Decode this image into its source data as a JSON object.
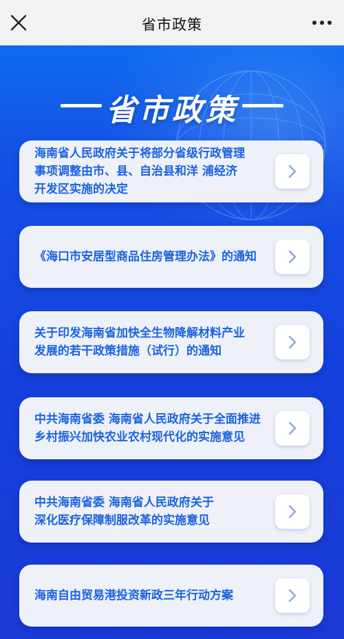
{
  "topbar": {
    "title": "省市政策",
    "close_icon": "close-icon",
    "more_icon": "more-icon"
  },
  "hero": {
    "title": "省市政策"
  },
  "policies": [
    {
      "label": "海南省人民政府关于将部分省级行政管理\n事项调整由市、县、自治县和洋 浦经济\n开发区实施的决定",
      "icon": "chevron-right-icon"
    },
    {
      "label": "《海口市安居型商品住房管理办法》的通知",
      "icon": "chevron-right-icon"
    },
    {
      "label": "关于印发海南省加快全生物降解材料产业\n发展的若干政策措施（试行）的通知",
      "icon": "chevron-right-icon"
    },
    {
      "label": "中共海南省委 海南省人民政府关于全面推进\n乡村振兴加快农业农村现代化的实施意见",
      "icon": "chevron-right-icon"
    },
    {
      "label": "中共海南省委 海南省人民政府关于\n深化医疗保障制服改革的实施意见",
      "icon": "chevron-right-icon"
    },
    {
      "label": "海南自由贸易港投资新政三年行动方案",
      "icon": "chevron-right-icon"
    }
  ],
  "colors": {
    "background_blue": "#1540dc",
    "card_bg": "#eef1f8",
    "card_text": "#1c63e0"
  }
}
